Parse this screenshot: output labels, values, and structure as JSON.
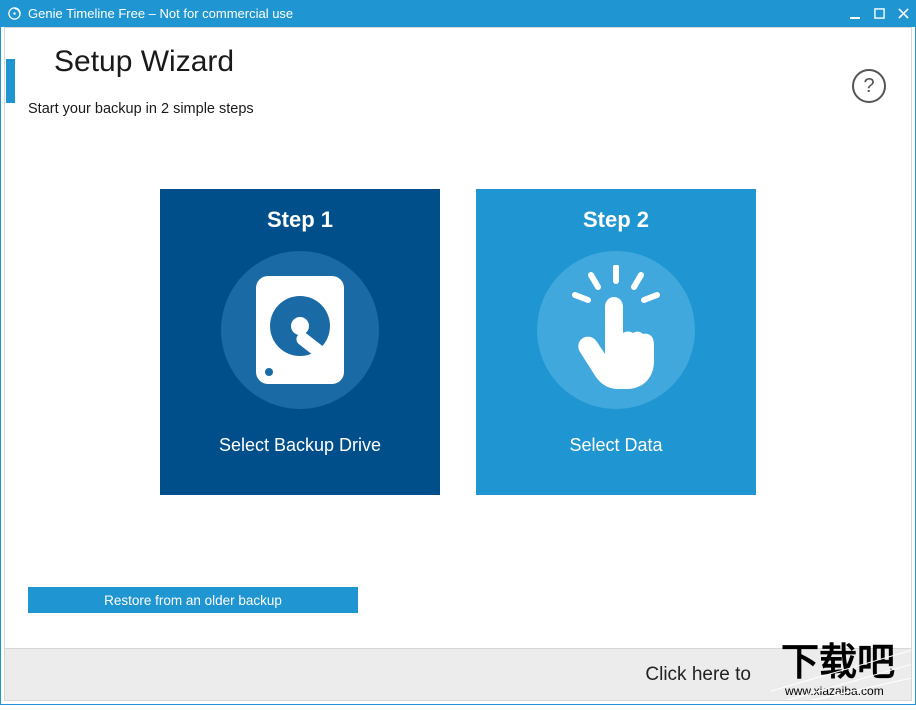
{
  "window": {
    "title": "Genie Timeline Free – Not for commercial use"
  },
  "header": {
    "title": "Setup Wizard",
    "subtitle": "Start your backup in 2 simple steps",
    "help_tooltip": "?"
  },
  "steps": [
    {
      "title": "Step 1",
      "label": "Select Backup Drive"
    },
    {
      "title": "Step 2",
      "label": "Select Data"
    }
  ],
  "restore_button": "Restore from an older backup",
  "footer": {
    "hint": "Click here to"
  },
  "watermark": {
    "text_cn": "下载吧",
    "url": "www.xiazaiba.com"
  }
}
